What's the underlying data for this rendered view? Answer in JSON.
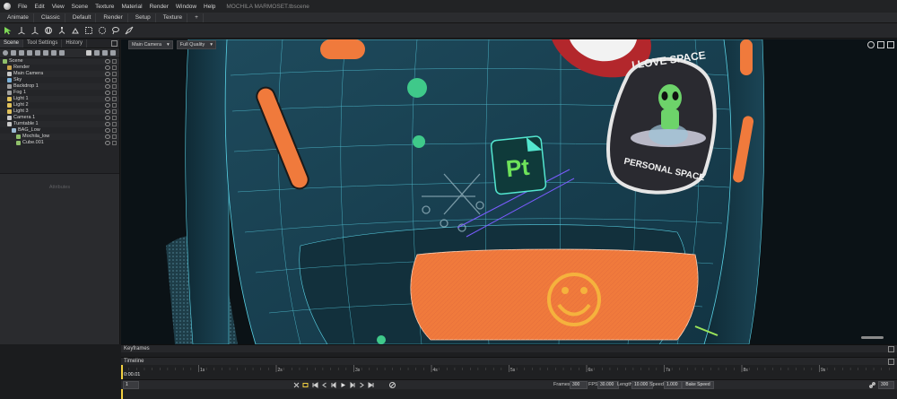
{
  "titlebar": {
    "menus": [
      "File",
      "Edit",
      "View",
      "Scene",
      "Texture",
      "Material",
      "Render",
      "Window",
      "Help"
    ],
    "file_title": "MOCHILA MARMOSET.tbscene"
  },
  "workspace_tabs": [
    "Animate",
    "Classic",
    "Default",
    "Render",
    "Setup",
    "Texture",
    "+"
  ],
  "panel_tabs": [
    "Scene",
    "Tool Settings",
    "History"
  ],
  "scene_tree": [
    {
      "label": "Scene",
      "depth": 0,
      "icon": "scene",
      "color": "#8fbf6a"
    },
    {
      "label": "Render",
      "depth": 1,
      "icon": "render",
      "color": "#c9a24a"
    },
    {
      "label": "Main Camera",
      "depth": 1,
      "icon": "camera",
      "color": "#c9c9c9"
    },
    {
      "label": "Sky",
      "depth": 1,
      "icon": "sky",
      "color": "#7ab0d9"
    },
    {
      "label": "Backdrop 1",
      "depth": 1,
      "icon": "backdrop",
      "color": "#a0a0a0"
    },
    {
      "label": "Fog 1",
      "depth": 1,
      "icon": "fog",
      "color": "#a0a0a0"
    },
    {
      "label": "Light 1",
      "depth": 1,
      "icon": "light",
      "color": "#e0c15a"
    },
    {
      "label": "Light 2",
      "depth": 1,
      "icon": "light",
      "color": "#e0c15a"
    },
    {
      "label": "Light 3",
      "depth": 1,
      "icon": "light",
      "color": "#e0c15a"
    },
    {
      "label": "Camera 1",
      "depth": 1,
      "icon": "camera",
      "color": "#c9c9c9"
    },
    {
      "label": "Turntable 1",
      "depth": 1,
      "icon": "turntable",
      "color": "#c9c9c9"
    },
    {
      "label": "BAG_Low",
      "depth": 2,
      "icon": "group",
      "color": "#9bbad3"
    },
    {
      "label": "Mochila_low",
      "depth": 3,
      "icon": "mesh",
      "color": "#8fbf6a"
    },
    {
      "label": "Cube.001",
      "depth": 3,
      "icon": "mesh",
      "color": "#8fbf6a"
    }
  ],
  "attr_panel_title": "Attributes",
  "viewport": {
    "camera_select": "Main Camera",
    "quality_select": "Full Quality",
    "sticker_top_text": "I LOVE SPACE",
    "sticker_bottom_text": "PERSONAL SPACE",
    "app_badge_text": "Pt"
  },
  "timeline": {
    "keyframes_label": "Keyframes",
    "timeline_label": "Timeline",
    "current_time": "0:00.01",
    "ruler_labels": [
      "1s",
      "2s",
      "3s",
      "4s",
      "5s",
      "6s",
      "7s",
      "8s",
      "9s"
    ],
    "frame_box": "1",
    "frames_label": "Frames",
    "frames_value": "300",
    "fps_label": "FPS",
    "fps_value": "30.000",
    "length_label": "Length",
    "length_value": "10.000",
    "speed_label": "Speed",
    "speed_value": "1.000",
    "bake_label": "Bake Speed",
    "end_value": "300"
  },
  "colors": {
    "bag_blue": "#1e4a5c",
    "wire": "#5ad3e6",
    "orange": "#f07a3c",
    "green_dot": "#3fc98a",
    "accent_green": "#9be65a"
  }
}
